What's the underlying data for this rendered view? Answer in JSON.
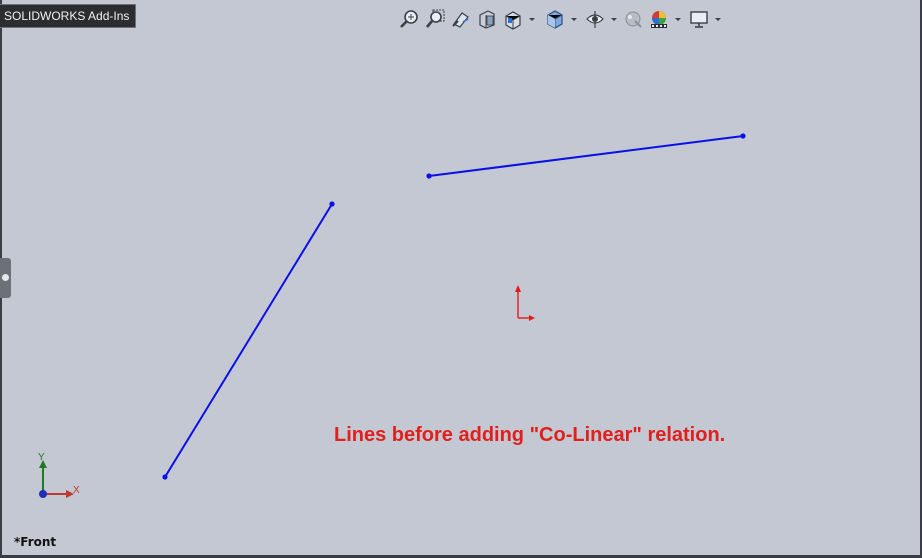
{
  "window": {
    "addins_tab_label": "SOLIDWORKS Add-Ins"
  },
  "heads_up_toolbar": {
    "icons": [
      "zoom-to-fit-icon",
      "zoom-to-area-icon",
      "previous-view-icon",
      "section-view-icon",
      "view-orientation-icon",
      "display-style-icon",
      "hide-show-items-icon",
      "edit-appearance-icon",
      "apply-scene-icon",
      "view-settings-icon"
    ]
  },
  "sketch": {
    "line_color": "#0a10e6",
    "origin_color": "#e31b17"
  },
  "annotation": {
    "text": "Lines before adding \"Co-Linear\" relation."
  },
  "view": {
    "label": "*Front"
  },
  "triad": {
    "x_label": "X",
    "y_label": "Y"
  },
  "colors": {
    "background": "#c4c8d3",
    "annotation": "#e0201c"
  }
}
